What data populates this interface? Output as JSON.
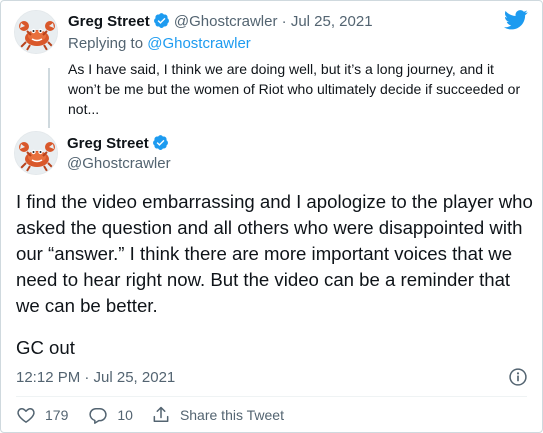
{
  "parent_tweet": {
    "author_name": "Greg Street",
    "handle": "@Ghostcrawler",
    "separator": "·",
    "date": "Jul 25, 2021",
    "replying_prefix": "Replying to",
    "replying_to": "@Ghostcrawler",
    "text": "As I have said, I think we are doing well, but it’s a long journey, and it won’t be me but the women of Riot who ultimately decide if succeeded or not..."
  },
  "main_tweet": {
    "author_name": "Greg Street",
    "handle": "@Ghostcrawler",
    "text": "I find the video embarrassing and I apologize to the player who asked the question and all others who were disappointed with our “answer.” I think there are more important voices that we need to hear right now. But the video can be a reminder that we can be better.",
    "signoff": "GC out",
    "timestamp": "12:12 PM · Jul 25, 2021"
  },
  "actions": {
    "likes": "179",
    "replies": "10",
    "share_label": "Share this Tweet"
  },
  "colors": {
    "brand_blue": "#1d9bf0",
    "secondary_text": "#536471",
    "primary_text": "#0f1419"
  },
  "icons": [
    "twitter-bird-icon",
    "verified-badge-icon",
    "info-icon",
    "heart-icon",
    "reply-bubble-icon",
    "share-icon"
  ]
}
